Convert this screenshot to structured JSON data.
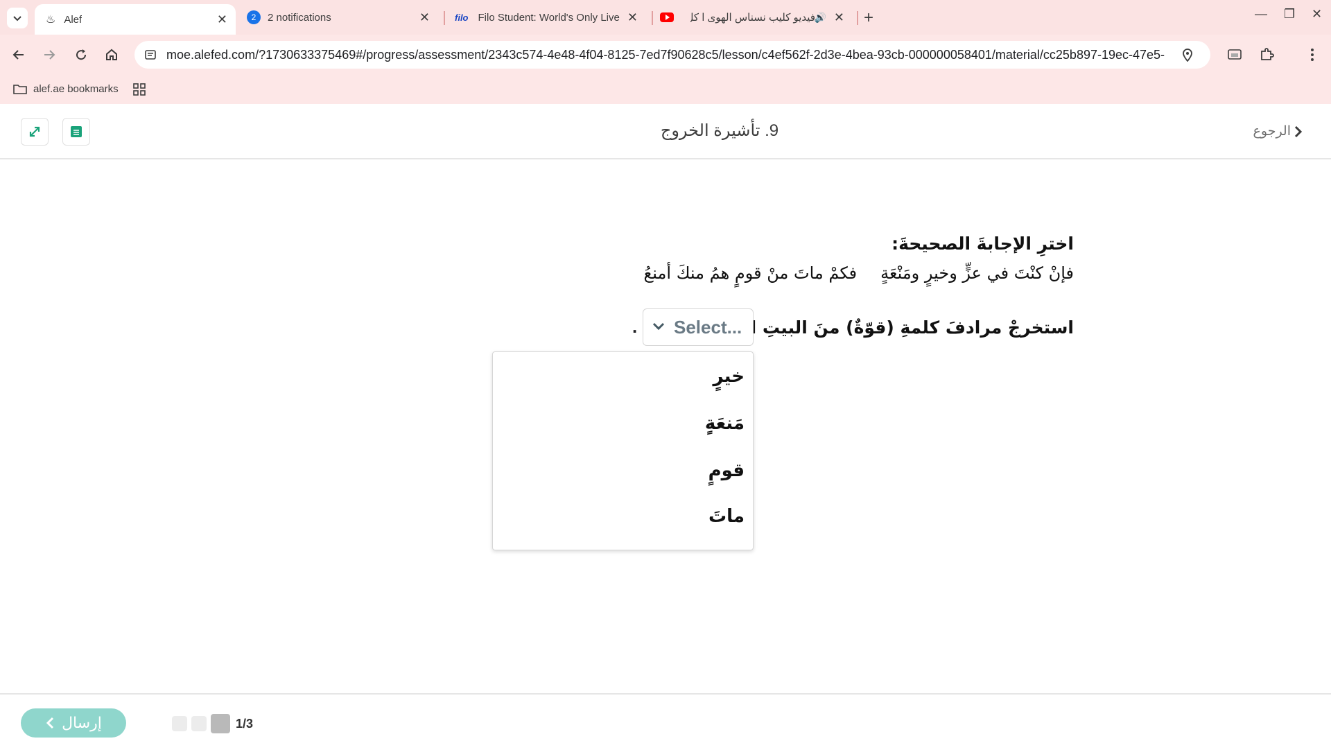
{
  "browser": {
    "tabs": [
      {
        "title": "Alef",
        "active": true
      },
      {
        "title": "2 notifications",
        "badge": "2"
      },
      {
        "title": "Filo Student: World's Only Live I",
        "logo": "filo"
      },
      {
        "title": "فيديو كليب نسناس الهوى ا كل"
      }
    ],
    "url": "moe.alefed.com/?1730633375469#/progress/assessment/2343c574-4e48-4f04-8125-7ed7f90628c5/lesson/c4ef562f-2d3e-4bea-93cb-000000058401/material/cc25b897-19ec-47e5-...",
    "bookmarks_label": "alef.ae bookmarks"
  },
  "header": {
    "title": "9. تأشيرة الخروج",
    "back_label": "الرجوع"
  },
  "question": {
    "heading": "اخترِ الإجابةَ الصحيحةَ:",
    "verse_first": "فإنْ كنْتَ في عزٍّ وخيرٍ ومَنْعَةٍ",
    "verse_second": "فكمْ ماتَ منْ قومٍ همُ منكَ أمنعُ",
    "prompt": "استخرجْ مرادفَ كلمةِ (قوّةٌ) منَ البيتِ السّابقِ:",
    "select_placeholder": "Select...",
    "period": ".",
    "options": [
      "خيرٍ",
      "مَنعَةٍ",
      "قومٍ",
      "ماتَ"
    ]
  },
  "footer": {
    "submit_label": "إرسال",
    "pager_text": "1/3"
  },
  "colors": {
    "chrome_bg": "#fde7e7",
    "accent_green": "#1aa37a",
    "submit_bg": "#8fd6cc"
  }
}
